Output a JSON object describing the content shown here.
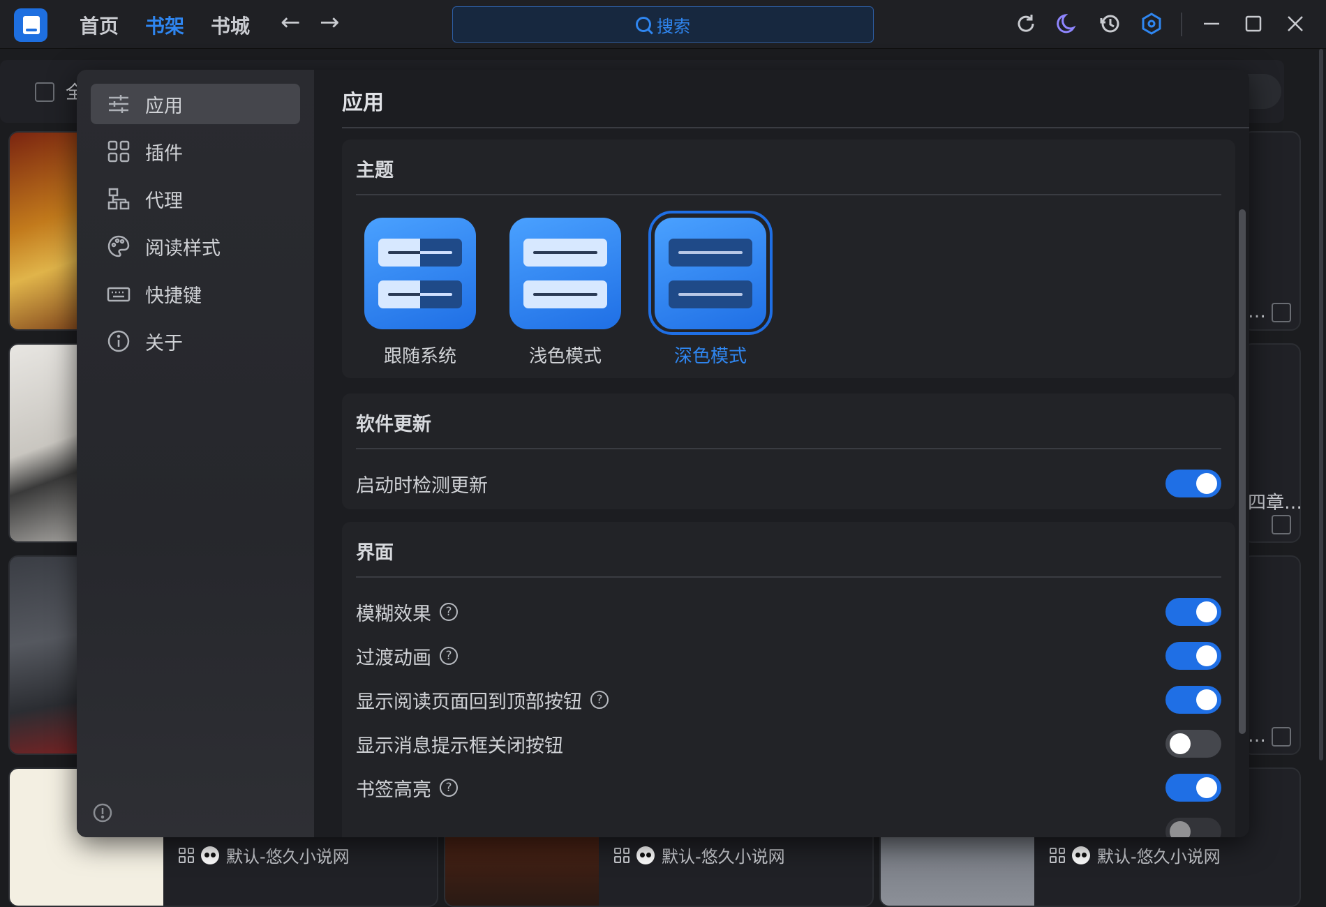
{
  "titlebar": {
    "tabs": [
      "首页",
      "书架",
      "书城"
    ],
    "active_tab": "书架",
    "back_glyph": "←",
    "forward_glyph": "→",
    "search_label": "搜索",
    "icons": [
      "refresh-icon",
      "moon-icon",
      "history-icon",
      "settings-hex-icon",
      "minimize-icon",
      "maximize-icon",
      "close-icon"
    ]
  },
  "shelf": {
    "select_all_label": "全",
    "cards": [
      {
        "ellipsis": "…"
      },
      {
        "ellipsis": "四章…"
      },
      {
        "ellipsis": "…"
      }
    ],
    "sources": [
      "默认-悠久小说网",
      "默认-悠久小说网",
      "默认-悠久小说网"
    ]
  },
  "dialog": {
    "title": "应用",
    "sidebar": [
      {
        "label": "应用",
        "icon": "sliders-icon",
        "active": true
      },
      {
        "label": "插件",
        "icon": "grid-icon",
        "active": false
      },
      {
        "label": "代理",
        "icon": "network-icon",
        "active": false
      },
      {
        "label": "阅读样式",
        "icon": "palette-icon",
        "active": false
      },
      {
        "label": "快捷键",
        "icon": "keyboard-icon",
        "active": false
      },
      {
        "label": "关于",
        "icon": "info-icon",
        "active": false
      }
    ],
    "theme": {
      "title": "主题",
      "options": [
        {
          "label": "跟随系统",
          "selected": false
        },
        {
          "label": "浅色模式",
          "selected": false
        },
        {
          "label": "深色模式",
          "selected": true
        }
      ]
    },
    "update": {
      "title": "软件更新",
      "rows": [
        {
          "label": "启动时检测更新",
          "help": false,
          "on": true
        }
      ]
    },
    "interface": {
      "title": "界面",
      "rows": [
        {
          "label": "模糊效果",
          "help": true,
          "on": true
        },
        {
          "label": "过渡动画",
          "help": true,
          "on": true
        },
        {
          "label": "显示阅读页面回到顶部按钮",
          "help": true,
          "on": true
        },
        {
          "label": "显示消息提示框关闭按钮",
          "help": false,
          "on": false
        },
        {
          "label": "书签高亮",
          "help": true,
          "on": true
        }
      ]
    },
    "help_glyph": "?"
  },
  "colors": {
    "accent": "#1f6fe5",
    "accent_text": "#2f86f0",
    "background": "#1b1c1f",
    "dialog": "#1c1d21",
    "section": "#222327"
  }
}
